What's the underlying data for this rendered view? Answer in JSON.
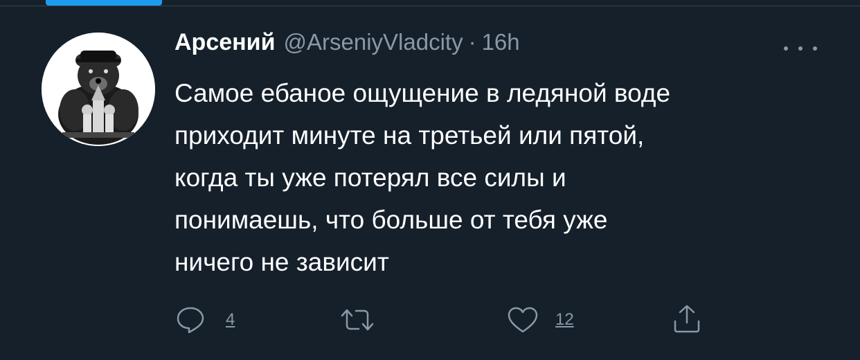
{
  "tweet": {
    "display_name": "Арсений",
    "handle": "@ArseniyVladcity",
    "separator": "·",
    "timestamp": "16h",
    "text_lines": [
      "Самое ебаное ощущение в ледяной воде",
      "приходит минуте на третьей или пятой,",
      "когда ты уже потерял все силы и",
      "понимаешь, что больше от тебя уже",
      "ничего не зависит"
    ],
    "icons": {
      "avatar": "bear-kremlin-avatar",
      "more": "more-options-icon",
      "reply": "reply-icon",
      "retweet": "retweet-icon",
      "like": "heart-icon",
      "share": "share-icon"
    },
    "actions": {
      "reply_count": "4",
      "retweet_count": "",
      "like_count": "12"
    }
  },
  "colors": {
    "background": "#15202b",
    "text_primary": "#ffffff",
    "text_secondary": "#8b98a5",
    "accent": "#1d9bf0"
  }
}
